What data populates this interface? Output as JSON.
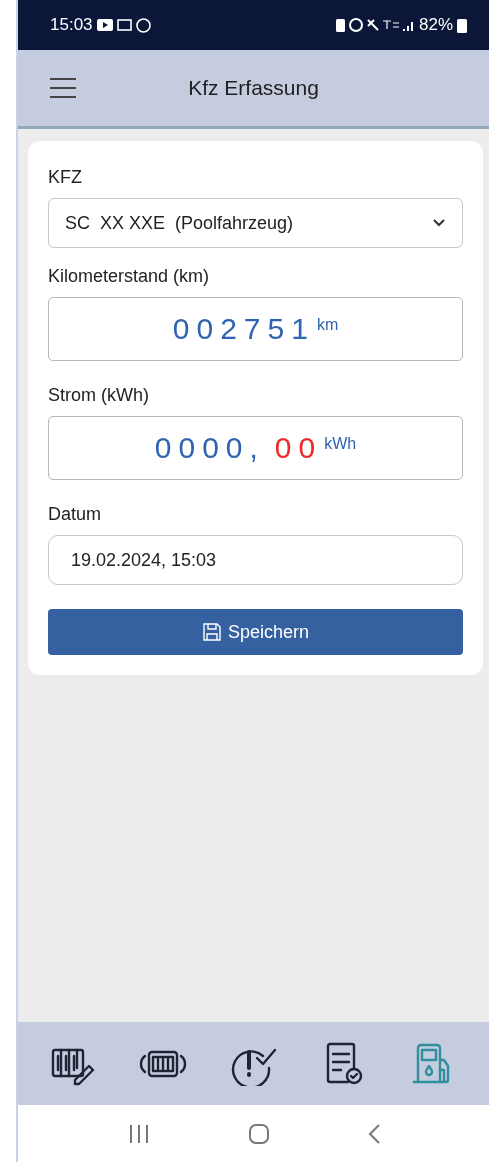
{
  "status_bar": {
    "time": "15:03",
    "battery": "82%"
  },
  "app_bar": {
    "title": "Kfz Erfassung"
  },
  "form": {
    "vehicle": {
      "label": "KFZ",
      "value": "SC  XX XXE  (Poolfahrzeug)"
    },
    "mileage": {
      "label": "Kilometerstand (km)",
      "digits": "002751",
      "unit": "km"
    },
    "power": {
      "label": "Strom (kWh)",
      "integer_digits": "0000",
      "separator": ",",
      "decimal_digits": "00",
      "unit": "kWh"
    },
    "date": {
      "label": "Datum",
      "value": "19.02.2024, 15:03"
    },
    "save_button": "Speichern"
  },
  "bottom_nav": [
    {
      "kind": "meter-edit",
      "selected": false
    },
    {
      "kind": "meter-swap",
      "selected": false
    },
    {
      "kind": "check",
      "selected": false
    },
    {
      "kind": "report",
      "selected": false
    },
    {
      "kind": "fuel",
      "selected": true
    }
  ]
}
